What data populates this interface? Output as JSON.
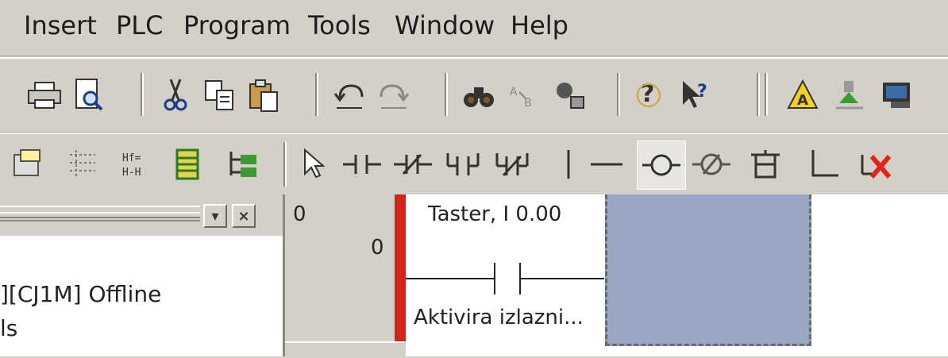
{
  "menu": {
    "items": [
      "Insert",
      "PLC",
      "Program",
      "Tools",
      "Window",
      "Help"
    ]
  },
  "toolbar_main": {
    "icons": [
      "print-icon",
      "print-preview-icon",
      "cut-icon",
      "copy-icon",
      "paste-icon",
      "undo-icon",
      "redo-icon",
      "find-icon",
      "find-replace-icon",
      "cross-reference-icon",
      "help-icon",
      "whats-this-icon",
      "warning-icon",
      "monitor-icon",
      "online-icon"
    ]
  },
  "toolbar_ladder": {
    "icons": [
      "properties-icon",
      "grid-icon",
      "symbol-table-icon",
      "io-table-icon",
      "network-tree-icon",
      "select-pointer-icon",
      "contact-no-icon",
      "contact-nc-icon",
      "contact-or-no-icon",
      "contact-or-nc-icon",
      "vertical-line-icon",
      "horizontal-line-icon",
      "coil-icon",
      "coil-nc-icon",
      "instruction-block-icon",
      "corner-line-icon",
      "delete-icon"
    ]
  },
  "left_panel": {
    "project_line": "][CJ1M] Offline",
    "second_line": "ls"
  },
  "ladder": {
    "rung_number": "0",
    "step_number": "0",
    "contact_address": "Taster, I 0.00",
    "contact_comment": "Aktivira izlazni..."
  },
  "colors": {
    "chrome": "#d4d0c8",
    "rung_marker": "#d0241d",
    "selection": "#9aa5c4"
  }
}
